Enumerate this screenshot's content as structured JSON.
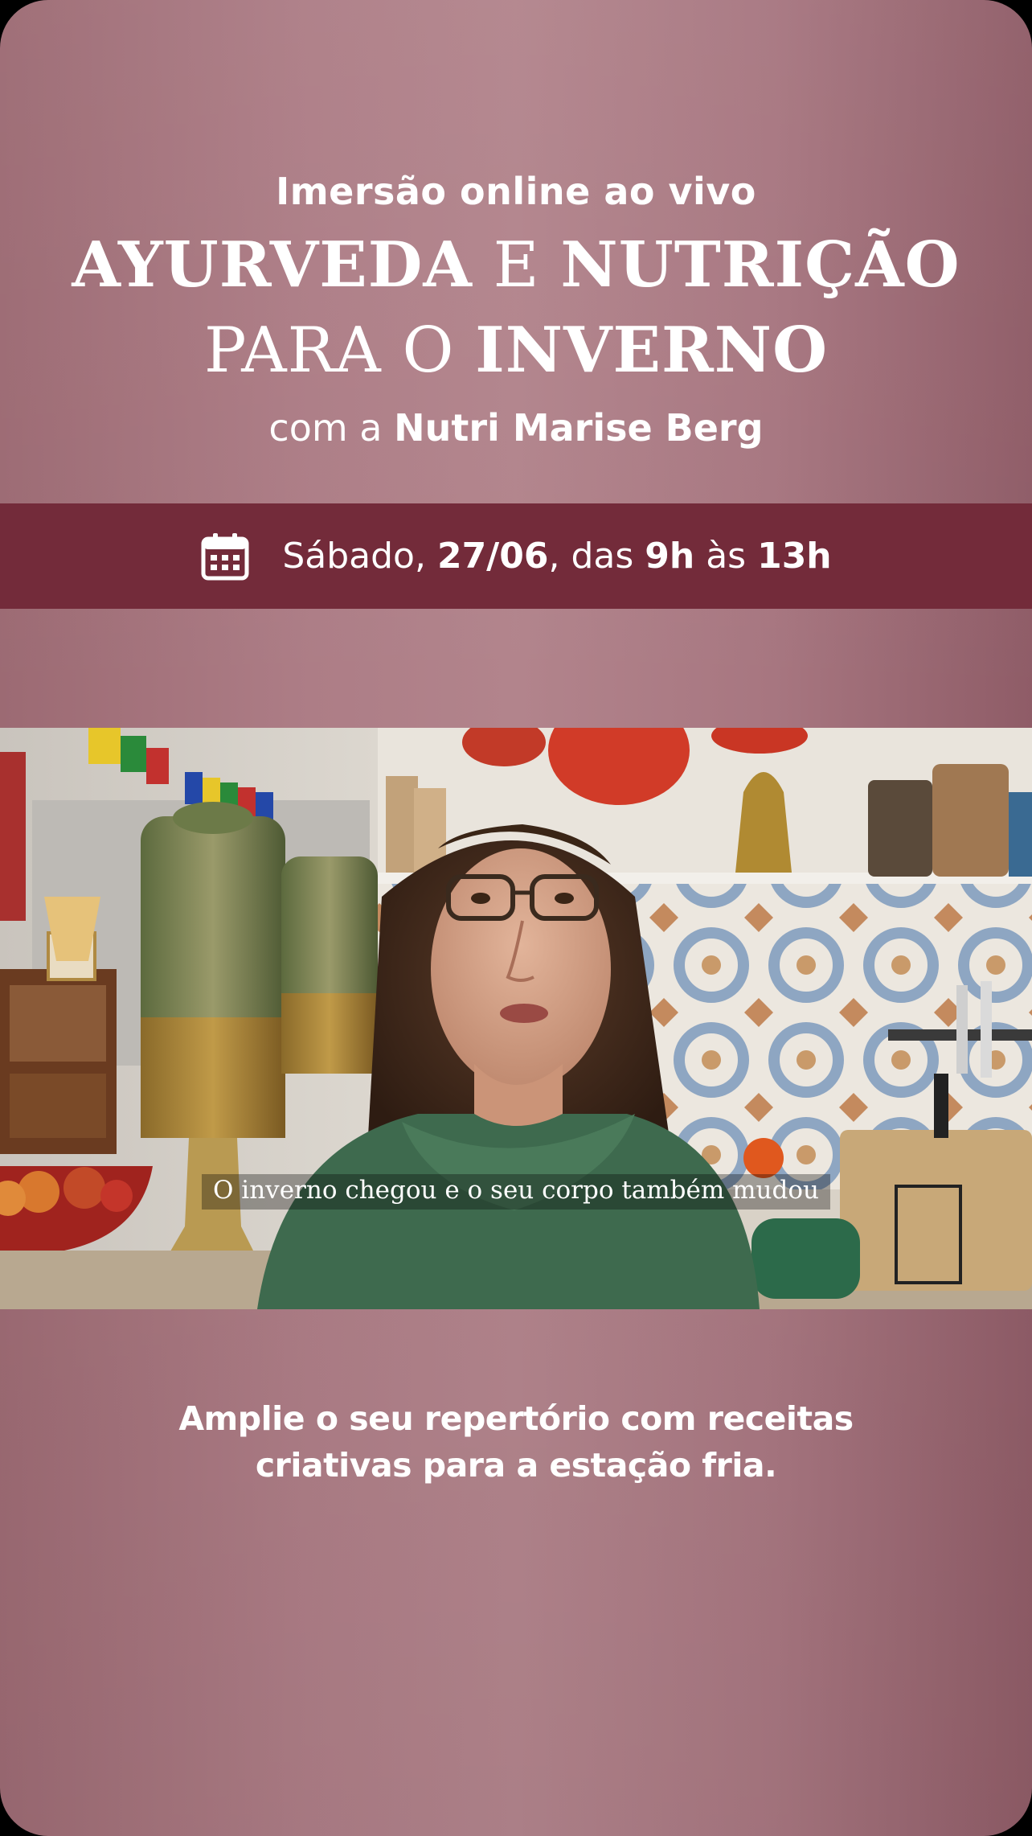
{
  "header": {
    "subtitle": "Imersão online ao vivo",
    "title_line1": {
      "part1": "AYURVEDA",
      "part2": " E ",
      "part3": "NUTRIÇÃO"
    },
    "title_line2": {
      "part1": "PARA O ",
      "part2": "INVERNO"
    },
    "with": {
      "prefix": "com a ",
      "name": "Nutri Marise Berg"
    }
  },
  "date_band": {
    "icon": "calendar-icon",
    "day": "Sábado, ",
    "date": "27/06",
    "between": ", das ",
    "start": "9h",
    "mid": " às ",
    "end": "13h",
    "color": "#732b3a"
  },
  "video": {
    "caption": "O inverno chegou e o seu corpo também mudou"
  },
  "bottom": {
    "line1": "Amplie o seu repertório com receitas",
    "line2": "criativas para a estação fria."
  },
  "colors": {
    "background": "#ad7d86",
    "text": "#ffffff"
  }
}
